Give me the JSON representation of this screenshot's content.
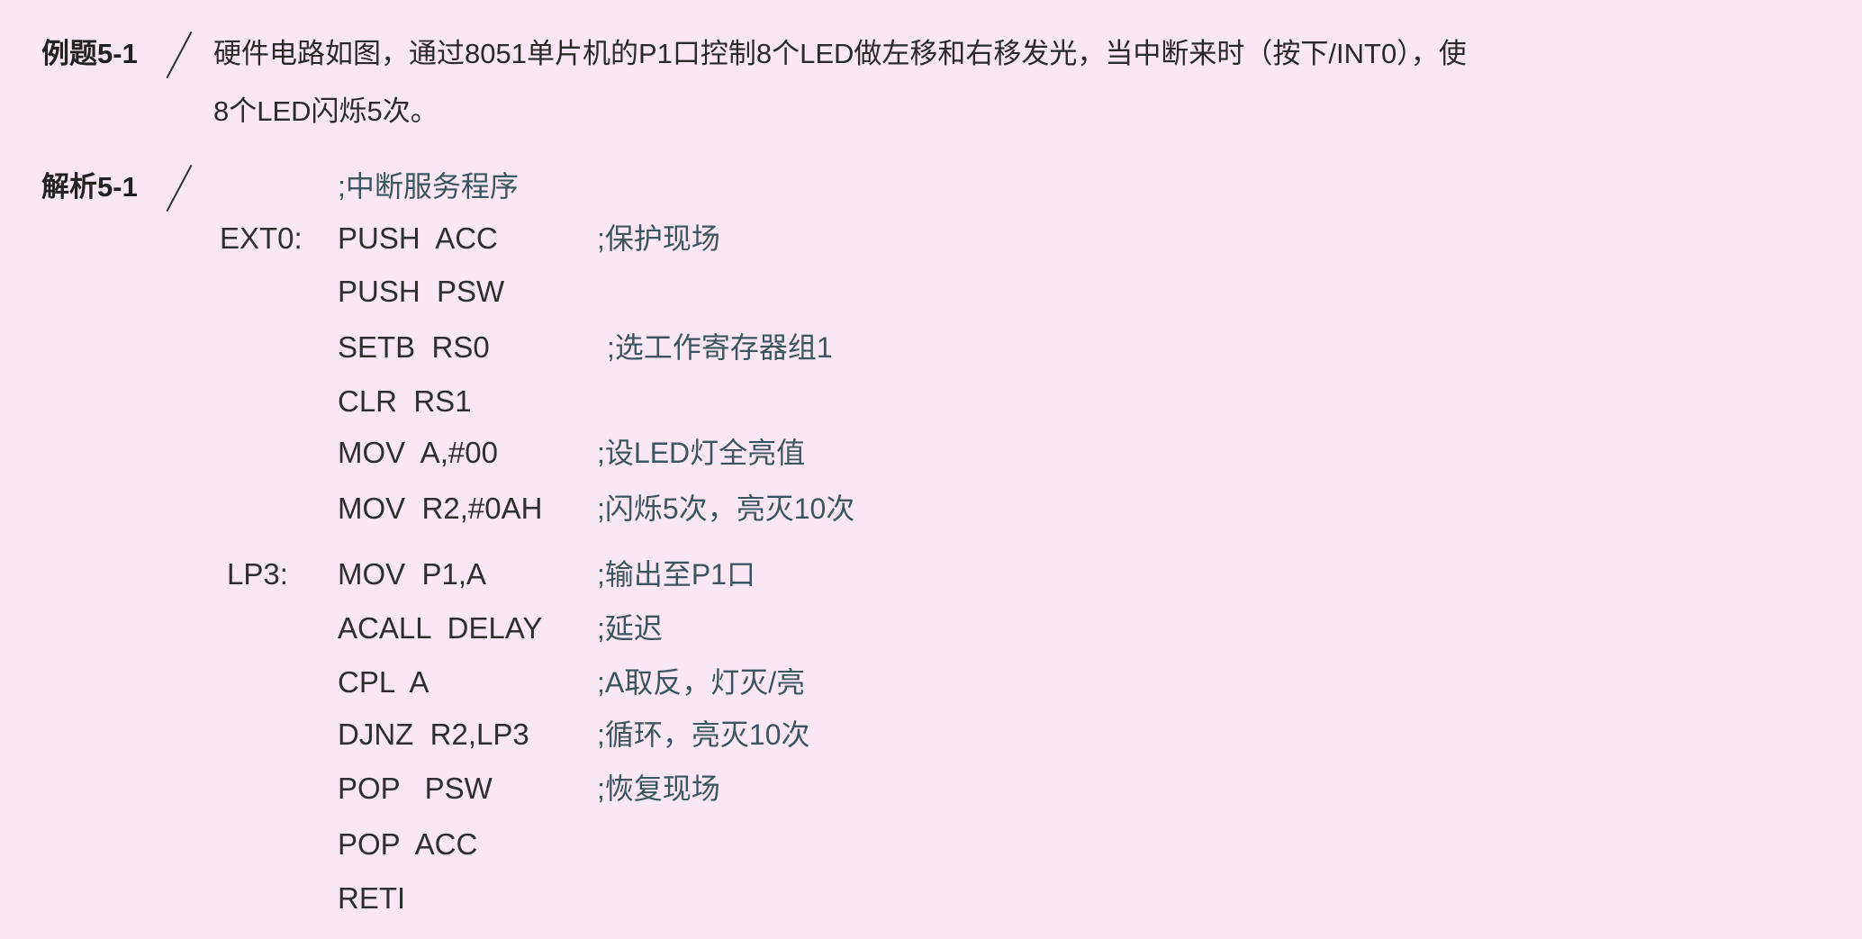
{
  "example": {
    "tag": "例题5-1",
    "line1": "硬件电路如图，通过8051单片机的P1口控制8个LED做左移和右移发光，当中断来时（按下/INT0），使",
    "line2": "8个LED闪烁5次。"
  },
  "analysis": {
    "tag": "解析5-1",
    "header_comment": ";中断服务程序",
    "lines": [
      {
        "label": "EXT0:",
        "instr": "PUSH  ACC",
        "comment": ";保护现场"
      },
      {
        "label": "",
        "instr": "PUSH  PSW",
        "comment": ""
      },
      {
        "label": "",
        "instr": "SETB  RS0",
        "comment": ";选工作寄存器组1"
      },
      {
        "label": "",
        "instr": "CLR  RS1",
        "comment": ""
      },
      {
        "label": "",
        "instr": "MOV  A,#00",
        "comment": ";设LED灯全亮值"
      },
      {
        "label": "",
        "instr": "MOV  R2,#0AH",
        "comment": ";闪烁5次，亮灭10次"
      },
      {
        "label": "LP3:",
        "instr": "MOV  P1,A",
        "comment": ";输出至P1口"
      },
      {
        "label": "",
        "instr": "ACALL  DELAY",
        "comment": ";延迟"
      },
      {
        "label": "",
        "instr": "CPL  A",
        "comment": ";A取反，灯灭/亮"
      },
      {
        "label": "",
        "instr": "DJNZ  R2,LP3",
        "comment": ";循环，亮灭10次"
      },
      {
        "label": "",
        "instr": "POP   PSW",
        "comment": ";恢复现场"
      },
      {
        "label": "",
        "instr": "POP  ACC",
        "comment": ""
      },
      {
        "label": "",
        "instr": "RETI",
        "comment": ""
      }
    ]
  }
}
